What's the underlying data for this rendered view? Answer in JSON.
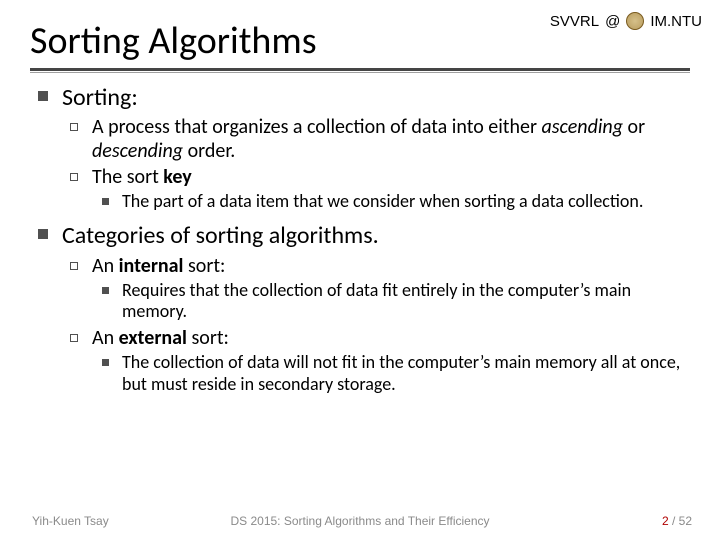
{
  "header": {
    "org_left": "SVVRL",
    "at": "@",
    "org_right": "IM.NTU"
  },
  "title": "Sorting Algorithms",
  "points": {
    "sorting_label": "Sorting:",
    "sorting_def_a": "A process that organizes a collection of data into either ",
    "sorting_def_asc": "ascending",
    "sorting_def_or": " or ",
    "sorting_def_desc": "descending",
    "sorting_def_b": " order.",
    "sortkey_a": "The sort ",
    "sortkey_b": "key",
    "sortkey_def": "The part of a data item that we consider when sorting a data collection.",
    "categories_label": "Categories of sorting algorithms.",
    "internal_a": "An ",
    "internal_b": "internal",
    "internal_c": " sort:",
    "internal_def": "Requires that the collection of data fit entirely in the computer’s main memory.",
    "external_a": "An ",
    "external_b": "external",
    "external_c": " sort:",
    "external_def": "The collection of data will not fit in the computer’s main memory all at once, but must reside in secondary storage."
  },
  "footer": {
    "author": "Yih-Kuen Tsay",
    "course": "DS 2015: Sorting Algorithms and Their Efficiency",
    "page_current": "2",
    "page_sep": " / ",
    "page_total": "52"
  }
}
